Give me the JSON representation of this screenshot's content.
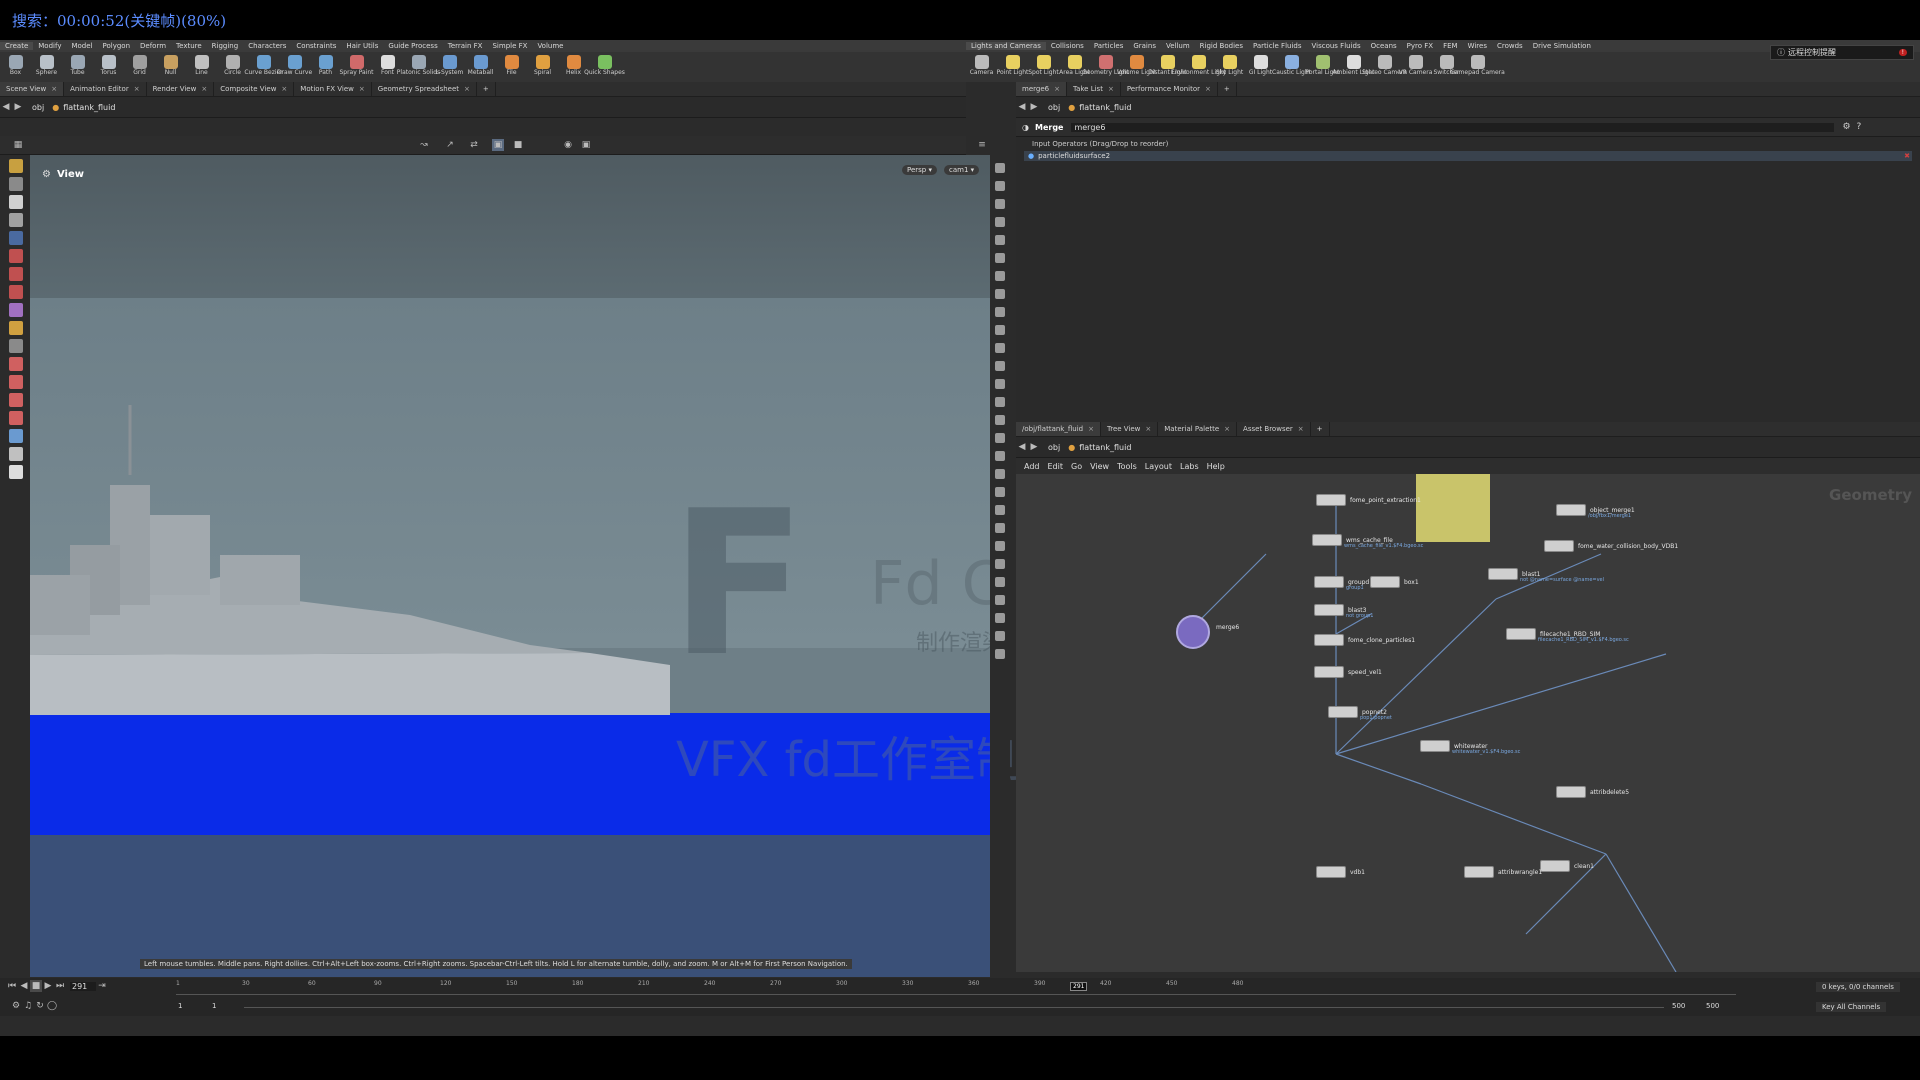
{
  "overlay": {
    "search_text": "搜索：00:00:52(关键帧)(80%)"
  },
  "left_menu": {
    "items": [
      "Create",
      "Modify",
      "Model",
      "Polygon",
      "Deform",
      "Texture",
      "Rigging",
      "Characters",
      "Constraints",
      "Hair Utils",
      "Guide Process",
      "Terrain FX",
      "Simple FX",
      "Volume"
    ]
  },
  "right_menu": {
    "items": [
      "Lights and Cameras",
      "Collisions",
      "Particles",
      "Grains",
      "Vellum",
      "Rigid Bodies",
      "Particle Fluids",
      "Viscous Fluids",
      "Oceans",
      "Pyro FX",
      "FEM",
      "Wires",
      "Crowds",
      "Drive Simulation"
    ]
  },
  "left_shelf": {
    "tools": [
      {
        "label": "Box",
        "color": "#9aa7b4"
      },
      {
        "label": "Sphere",
        "color": "#b8c0c8"
      },
      {
        "label": "Tube",
        "color": "#9aa7b4"
      },
      {
        "label": "Torus",
        "color": "#b8c0c8"
      },
      {
        "label": "Grid",
        "color": "#a0a0a0"
      },
      {
        "label": "Null",
        "color": "#c8a060"
      },
      {
        "label": "Line",
        "color": "#c0c0c0"
      },
      {
        "label": "Circle",
        "color": "#b0b0b0"
      },
      {
        "label": "Curve Bezier",
        "color": "#6aa0d0"
      },
      {
        "label": "Draw Curve",
        "color": "#6aa0d0"
      },
      {
        "label": "Path",
        "color": "#6aa0d0"
      },
      {
        "label": "Spray Paint",
        "color": "#d06a6a"
      },
      {
        "label": "Font",
        "color": "#dddddd"
      },
      {
        "label": "Platonic Solids",
        "color": "#9aa7b4"
      },
      {
        "label": "L-System",
        "color": "#6a9ad0"
      },
      {
        "label": "Metaball",
        "color": "#6a9ad0"
      },
      {
        "label": "File",
        "color": "#e08a40"
      },
      {
        "label": "Spiral",
        "color": "#e0a040"
      },
      {
        "label": "Helix",
        "color": "#e08a40"
      },
      {
        "label": "Quick Shapes",
        "color": "#7ac060"
      }
    ]
  },
  "right_shelf": {
    "tools": [
      {
        "label": "Camera",
        "color": "#bbbbbb"
      },
      {
        "label": "Point Light",
        "color": "#e8d060"
      },
      {
        "label": "Spot Light",
        "color": "#e8d060"
      },
      {
        "label": "Area Light",
        "color": "#e8d060"
      },
      {
        "label": "Geometry Light",
        "color": "#d07070"
      },
      {
        "label": "Volume Light",
        "color": "#e08a40"
      },
      {
        "label": "Distant Light",
        "color": "#e8d060"
      },
      {
        "label": "Environment Light",
        "color": "#e8d060"
      },
      {
        "label": "Sky Light",
        "color": "#e8d060"
      },
      {
        "label": "GI Light",
        "color": "#dddddd"
      },
      {
        "label": "Caustic Light",
        "color": "#8ab0e0"
      },
      {
        "label": "Portal Light",
        "color": "#a0c070"
      },
      {
        "label": "Ambient Light",
        "color": "#dddddd"
      },
      {
        "label": "Stereo Camera",
        "color": "#bbbbbb"
      },
      {
        "label": "VR Camera",
        "color": "#bbbbbb"
      },
      {
        "label": "Switcher",
        "color": "#bbbbbb"
      },
      {
        "label": "Gamepad Camera",
        "color": "#bbbbbb"
      }
    ]
  },
  "remote_control": {
    "label": "远程控制提醒",
    "badge": "!"
  },
  "left_tabs": [
    {
      "label": "Scene View",
      "active": true
    },
    {
      "label": "Animation Editor"
    },
    {
      "label": "Render View"
    },
    {
      "label": "Composite View"
    },
    {
      "label": "Motion FX View"
    },
    {
      "label": "Geometry Spreadsheet"
    }
  ],
  "right_top_tabs": [
    {
      "label": "merge6",
      "active": true
    },
    {
      "label": "Take List"
    },
    {
      "label": "Performance Monitor"
    }
  ],
  "right_bottom_tabs": [
    {
      "label": "/obj/flattank_fluid",
      "active": true
    },
    {
      "label": "Tree View"
    },
    {
      "label": "Material Palette"
    },
    {
      "label": "Asset Browser"
    }
  ],
  "path": {
    "context": "obj",
    "node": "flattank_fluid"
  },
  "viewport": {
    "title": "View",
    "projection": "Persp",
    "camera": "cam1",
    "hint": "Left mouse tumbles. Middle pans. Right dollies. Ctrl+Alt+Left box-zooms. Ctrl+Right zooms. Spacebar-Ctrl-Left tilts. Hold L for alternate tumble, dolly, and zoom. M or Alt+M for First Person Navigation."
  },
  "watermark": {
    "logo": "F",
    "text": "Fd CG工作室",
    "sub": "制作渲染 · 授权必究",
    "bottom": "VFX fd工作室制作渲染"
  },
  "merge_params": {
    "type": "Merge",
    "name": "merge6",
    "section": "Input Operators (Drag/Drop to reorder)",
    "input": "particlefluidsurface2"
  },
  "network_menu": [
    "Add",
    "Edit",
    "Go",
    "View",
    "Tools",
    "Layout",
    "Labs",
    "Help"
  ],
  "network_context": "Geometry",
  "nodes": [
    {
      "label": "fome_point_extraction1",
      "sub": ""
    },
    {
      "label": "wms_cache_file",
      "sub": "wms_cache_file_v1.$F4.bgeo.sc"
    },
    {
      "label": "groupd",
      "sub": "group1"
    },
    {
      "label": "box1",
      "sub": ""
    },
    {
      "label": "blast3",
      "sub": "not group1"
    },
    {
      "label": "fome_clone_particles1",
      "sub": ""
    },
    {
      "label": "speed_vel1",
      "sub": ""
    },
    {
      "label": "popnet2",
      "sub": "pop1:popnet"
    },
    {
      "label": "whitewater",
      "sub": "whitewater_v1.$F4.bgeo.sc"
    },
    {
      "label": "merge6",
      "sub": ""
    },
    {
      "label": "object_merge1",
      "sub": "/obj/fbx1/merge1"
    },
    {
      "label": "fome_water_collision_body_VDB1",
      "sub": ""
    },
    {
      "label": "blast1",
      "sub": "not @name=surface @name=vel"
    },
    {
      "label": "filecache1_RBD_SIM",
      "sub": "filecache1_RBD_SIM_v1.$F4.bgeo.sc"
    },
    {
      "label": "attribdelete5",
      "sub": ""
    },
    {
      "label": "clean1",
      "sub": ""
    },
    {
      "label": "attribwrangle1",
      "sub": ""
    },
    {
      "label": "vdb1",
      "sub": ""
    }
  ],
  "timeline": {
    "current_frame": "291",
    "ticks": [
      "1",
      "30",
      "60",
      "90",
      "120",
      "150",
      "180",
      "210",
      "240",
      "270",
      "300",
      "330",
      "360",
      "390",
      "420",
      "450",
      "480"
    ],
    "marker": "291",
    "range_start": "1",
    "range_start2": "1",
    "range_end": "500",
    "range_end2": "500",
    "keys_info": "0 keys, 0/0 channels",
    "key_all": "Key All Channels"
  }
}
